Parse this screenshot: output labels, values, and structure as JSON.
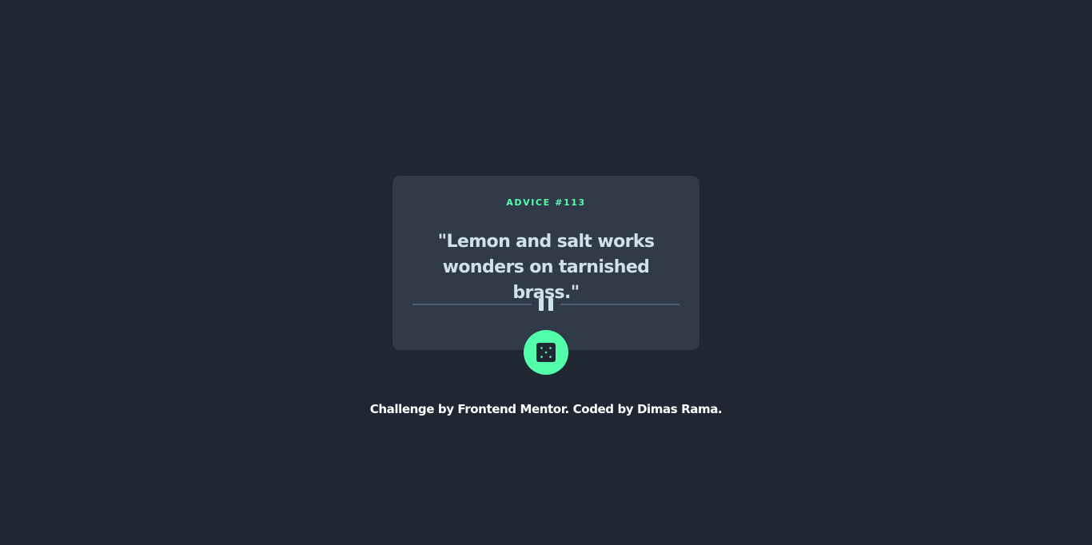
{
  "card": {
    "advice_id": "ADVICE #113",
    "advice_text": "\"Lemon and salt works wonders on tarnished brass.\""
  },
  "dice_button": {
    "icon": "dice-icon"
  },
  "divider": {
    "icon": "pause-icon"
  },
  "footer": {
    "attribution": "Challenge by Frontend Mentor. Coded by Dimas Rama."
  },
  "colors": {
    "background": "#202632",
    "card": "#313a48",
    "accent": "#53ffaa",
    "text": "#cee3e9",
    "divider": "#4f5d74"
  }
}
